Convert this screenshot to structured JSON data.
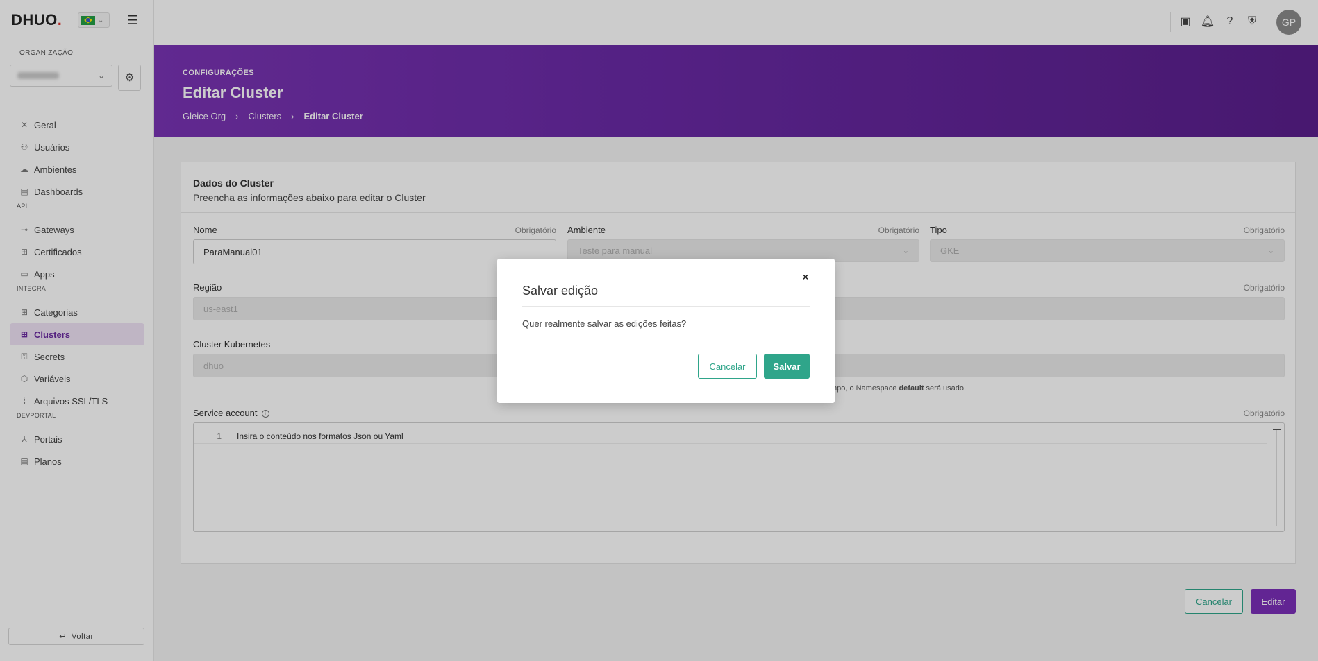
{
  "brand": {
    "logo_text": "DHUO",
    "logo_dot": "."
  },
  "sidebar": {
    "org_label": "ORGANIZAÇÃO",
    "items": [
      {
        "label": "Geral",
        "icon": "tools-icon",
        "glyph": "✕"
      },
      {
        "label": "Usuários",
        "icon": "users-icon",
        "glyph": "⚇"
      },
      {
        "label": "Ambientes",
        "icon": "cloud-icon",
        "glyph": "☁"
      },
      {
        "label": "Dashboards",
        "icon": "dashboard-icon",
        "glyph": "▤"
      },
      {
        "label": "Gateways",
        "icon": "gateway-icon",
        "glyph": "⊸"
      },
      {
        "label": "Certificados",
        "icon": "certificate-icon",
        "glyph": "⊞"
      },
      {
        "label": "Apps",
        "icon": "apps-icon",
        "glyph": "▭"
      },
      {
        "label": "Categorias",
        "icon": "categories-icon",
        "glyph": "⊞"
      },
      {
        "label": "Clusters",
        "icon": "clusters-icon",
        "glyph": "⊞"
      },
      {
        "label": "Secrets",
        "icon": "secrets-icon",
        "glyph": "⚿"
      },
      {
        "label": "Variáveis",
        "icon": "variables-icon",
        "glyph": "⬡"
      },
      {
        "label": "Arquivos SSL/TLS",
        "icon": "paperclip-icon",
        "glyph": "⌇"
      },
      {
        "label": "Portais",
        "icon": "portals-icon",
        "glyph": "⅄"
      },
      {
        "label": "Planos",
        "icon": "plans-icon",
        "glyph": "▤"
      }
    ],
    "sections": {
      "api": "API",
      "integra": "INTEGRA",
      "devportal": "DEVPORTAL"
    },
    "back_label": "Voltar"
  },
  "topbar": {
    "avatar_initials": "GP"
  },
  "banner": {
    "kicker": "CONFIGURAÇÕES",
    "title": "Editar Cluster",
    "breadcrumbs": [
      "Gleice Org",
      "Clusters",
      "Editar Cluster"
    ],
    "separator": "›"
  },
  "form": {
    "title": "Dados do Cluster",
    "subtitle": "Preencha as informações abaixo para editar o Cluster",
    "required_text": "Obrigatório",
    "nome": {
      "label": "Nome",
      "value": "ParaManual01"
    },
    "ambiente": {
      "label": "Ambiente",
      "value": "Teste para manual"
    },
    "tipo": {
      "label": "Tipo",
      "value": "GKE"
    },
    "regiao": {
      "label": "Região",
      "value": "us-east1"
    },
    "cluster_k8s": {
      "label": "Cluster Kubernetes",
      "value": "dhuo"
    },
    "namespace_hint": {
      "pre": "mpo, o Namespace ",
      "bold": "default",
      "post": " será usado."
    },
    "service_account": {
      "label": "Service account",
      "line_number": "1",
      "placeholder": "Insira o conteúdo nos formatos Json ou Yaml"
    },
    "cancel_label": "Cancelar",
    "edit_label": "Editar"
  },
  "modal": {
    "title": "Salvar edição",
    "message": "Quer realmente salvar as edições feitas?",
    "cancel_label": "Cancelar",
    "save_label": "Salvar",
    "close_glyph": "×"
  },
  "colors": {
    "accent_purple": "#7b2fb8",
    "accent_teal": "#2fa58a"
  }
}
